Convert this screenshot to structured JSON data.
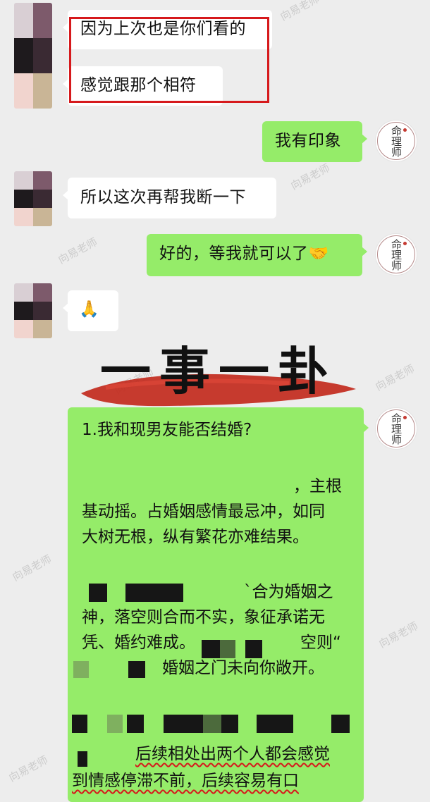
{
  "watermark": "向易老师",
  "logo": {
    "text": "命理师"
  },
  "messages": [
    {
      "side": "left",
      "text": "因为上次也是你们看的"
    },
    {
      "side": "left",
      "text": "感觉跟那个相符"
    },
    {
      "side": "right",
      "text": "我有印象"
    },
    {
      "side": "left",
      "text": "所以这次再帮我断一下"
    },
    {
      "side": "right",
      "text": "好的，等我就可以了🤝"
    },
    {
      "side": "left",
      "text": "🙏"
    }
  ],
  "banner": {
    "title": "一事一卦"
  },
  "reading": {
    "title": "1.我和现男友能否结婚?",
    "lines": [
      "，主根",
      "基动摇。占婚姻感情最忌冲，如同",
      "大树无根，纵有繁花亦难结果。",
      "`合为婚姻之",
      "神，落空则合而不实，象征承诺无",
      "凭、婚约难成。",
      "空则“",
      "婚姻之门未向你敞开。",
      "后续相处出两个人都会感觉",
      "到情感停滞不前，后续容易有口"
    ]
  }
}
